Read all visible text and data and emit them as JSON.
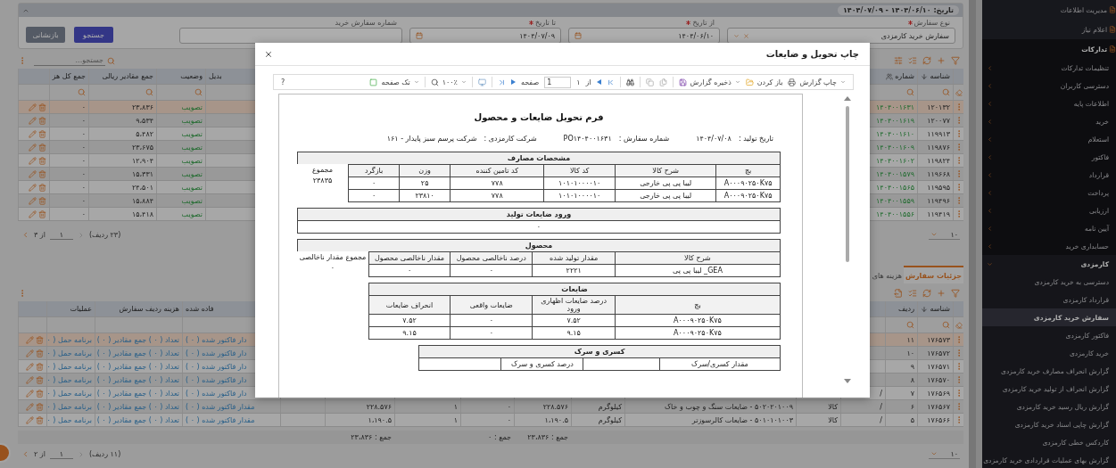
{
  "sidebar": {
    "items": [
      {
        "label": "مدیریت اطلاعات",
        "selected": false
      },
      {
        "label": "اعلام نیاز",
        "selected": false
      },
      {
        "label": "تدارکات",
        "selected": false,
        "children": [
          {
            "label": "تنظیمات تدارکات",
            "selected": false,
            "expanded": false
          },
          {
            "label": "دسترسی کاربران",
            "selected": false,
            "expanded": false
          },
          {
            "label": "اطلاعات پایه",
            "selected": false,
            "expanded": false
          },
          {
            "label": "خرید",
            "selected": false,
            "expanded": false
          },
          {
            "label": "استعلام",
            "selected": false,
            "expanded": false
          },
          {
            "label": "فاکتور",
            "selected": false,
            "expanded": false
          },
          {
            "label": "قرارداد",
            "selected": false,
            "expanded": false
          },
          {
            "label": "پرداخت",
            "selected": false,
            "expanded": false
          },
          {
            "label": "ارزیابی",
            "selected": false,
            "expanded": false
          },
          {
            "label": "آیین نامه",
            "selected": false,
            "expanded": false
          },
          {
            "label": "حسابداری خرید",
            "selected": false,
            "expanded": false
          },
          {
            "label": "کارمزدی",
            "selected": false,
            "expanded": true,
            "children": [
              {
                "label": "دسترسی به خرید کارمزدی",
                "selected": false
              },
              {
                "label": "قرارداد کارمزدی",
                "selected": false
              },
              {
                "label": "سفارش خرید کارمزدی",
                "selected": true
              },
              {
                "label": "فاکتور کارمزدی",
                "selected": false
              },
              {
                "label": "خرید کارمزدی",
                "selected": false
              },
              {
                "label": "گزارش انحراف مصارف خرید کارمزدی",
                "selected": false
              },
              {
                "label": "گزارش انحراف از تولید خرید کارمزدی",
                "selected": false
              },
              {
                "label": "گزارش ریال رسید خرید کارمزدی",
                "selected": false
              },
              {
                "label": "گزارش چاپی اسناد خرید کارمزدی",
                "selected": false
              },
              {
                "label": "کاردکس خطی کارمزدی",
                "selected": false
              },
              {
                "label": "گزارش بهای عملیات قراردادی خرید کارمزدی",
                "selected": false
              }
            ]
          }
        ]
      }
    ]
  },
  "filter": {
    "summary": "تاریخ: ۱۴۰۴/۰۶/۱۰ - ۱۴۰۴/۰۷/۰۹",
    "fields": [
      {
        "kind": "select",
        "label": "نوع سفارش",
        "required": true,
        "value": "سفارش خرید کارمزدی"
      },
      {
        "kind": "date",
        "label": "از تاریخ",
        "required": true,
        "value": "۱۴۰۴/۰۶/۱۰"
      },
      {
        "kind": "date",
        "label": "تا تاریخ",
        "required": true,
        "value": "۱۴۰۴/۰۷/۰۹"
      },
      {
        "kind": "text",
        "label": "شماره سفارش خرید",
        "required": false
      }
    ],
    "buttons": [
      {
        "kind": "primary",
        "label": "جستجو"
      },
      {
        "kind": "secondary",
        "label": "بازنشانی"
      }
    ]
  },
  "orders": {
    "search_placeholder": "جستجو...",
    "columns": {
      "id": {
        "label": "شناسه",
        "sorted_desc": true
      },
      "number": {
        "label": "شماره"
      },
      "col_3": {
        "label": "بدیل"
      },
      "status": {
        "label": "وضعیت"
      },
      "rial_total": {
        "label": "جمع مقادیر ریالی"
      },
      "total_cost": {
        "label": "جمع کل هز"
      }
    },
    "rows": [
      {
        "selected": true,
        "id": "۱۲۰۱۳۲",
        "number": "۱۴۰۴۰۰۱۶۳۱",
        "status": "تصویب",
        "rial_total": "۲۳،۸۳۶",
        "total_cost": "۰"
      },
      {
        "selected": false,
        "id": "۱۲۰۰۷۷",
        "number": "۱۴۰۴۰۰۱۶۱۹",
        "status": "تصویب",
        "rial_total": "۹،۵۳۴",
        "total_cost": "۰"
      },
      {
        "selected": false,
        "id": "۱۱۹۹۱۳",
        "number": "۱۴۰۴۰۰۱۶۱۰",
        "status": "تصویب",
        "rial_total": "۵،۴۸۲",
        "total_cost": "۰"
      },
      {
        "selected": false,
        "id": "۱۱۹۸۷۶",
        "number": "۱۴۰۴۰۰۱۶۰۹",
        "status": "تصویب",
        "rial_total": "۲۳،۶۷۵",
        "total_cost": "۰"
      },
      {
        "selected": false,
        "id": "۱۱۹۸۲۴",
        "number": "۱۴۰۴۰۰۱۶۰۲",
        "status": "تصویب",
        "rial_total": "۱۲،۹۰۴",
        "total_cost": "۰"
      },
      {
        "selected": false,
        "id": "۱۱۹۶۶۸",
        "number": "۱۴۰۴۰۰۱۵۷۹",
        "status": "تصویب",
        "rial_total": "۱۵،۳۳۱",
        "total_cost": "۰"
      },
      {
        "selected": false,
        "id": "۱۱۹۵۹۵",
        "number": "۱۴۰۴۰۰۱۵۶۵",
        "status": "تصویب",
        "rial_total": "۲۴،۵۰۱",
        "total_cost": "۰"
      },
      {
        "selected": false,
        "id": "۱۱۹۴۹۶",
        "number": "۱۴۰۴۰۰۱۵۵۹",
        "status": "تصویب",
        "rial_total": "۱۵،۸۸۴",
        "total_cost": "۰"
      },
      {
        "selected": false,
        "id": "۱۱۹۴۱۹",
        "number": "۱۴۰۴۰۰۱۵۵۶",
        "status": "تصویب",
        "rial_total": "۱۵،۴۱۸",
        "total_cost": "۰"
      }
    ],
    "pagination": {
      "rows_count": "(۲۳ ردیف)",
      "page": "۱",
      "of": "از ۳",
      "page_size": "۱۰"
    }
  },
  "order_details": {
    "tabs": [
      {
        "label": "جزئیات سفارش",
        "selected": true
      },
      {
        "label": "هزینه های",
        "selected": false
      }
    ],
    "columns": {
      "id": {
        "label": "شناسه",
        "sorted_desc": true
      },
      "row_no": {
        "label": "ردیف"
      },
      "invoiced": {
        "label": "فاده شده"
      },
      "order_row_cost": {
        "label": "هزینه ردیف سفارش"
      },
      "operations": {
        "label": "عملیات"
      }
    },
    "rows": [
      {
        "selected": true,
        "id": "۱۷۶۵۷۳",
        "row_no": "۱۱",
        "invoiced": "دار فاکتور شده ( ۰ )",
        "order_row_cost": "تعداد ( ۰ ) جمع مقادیر ( ۰ )",
        "operations": "برنامه حمل ( ۰"
      },
      {
        "selected": false,
        "id": "۱۷۶۵۷۲",
        "row_no": "۱۰",
        "invoiced": "دار فاکتور شده ( ۰ )",
        "order_row_cost": "تعداد ( ۰ ) جمع مقادیر ( ۰ )",
        "operations": "برنامه حمل ( ۰"
      },
      {
        "selected": false,
        "id": "۱۷۶۵۷۱",
        "row_no": "۹",
        "invoiced": "دار فاکتور شده ( ۰ )",
        "order_row_cost": "تعداد ( ۰ ) جمع مقادیر ( ۰ )",
        "operations": "برنامه حمل ( ۰"
      },
      {
        "selected": false,
        "id": "۱۷۶۵۷۰",
        "row_no": "۸",
        "invoiced": "دار فاکتور شده ( ۰ )",
        "order_row_cost": "تعداد ( ۰ ) جمع مقادیر ( ۰ )",
        "operations": "برنامه حمل ( ۰"
      },
      {
        "selected": false,
        "id": "۱۷۶۵۶۹",
        "row_no": "۷",
        "col_4": "/",
        "invoiced": "دار فاکتور شده ( ۰ )",
        "order_row_cost": "تعداد ( ۰ ) جمع مقادیر ( ۰ )",
        "operations": "برنامه حمل ( ۰"
      },
      {
        "selected": false,
        "id": "۱۷۶۵۶۷",
        "row_no": "۶",
        "col_4": "/",
        "col_5": "کالا",
        "col_6": "۵۰۲۰۲۰۱۰۰۹ - ضایعات سنگ و چوب و خاک",
        "col_7": "کیلوگرم",
        "col_8": "۲۲۸.۵۷۶",
        "col_9": "۰",
        "col_10": "۱",
        "col_11": "۲۲۸.۵۷۶",
        "invoiced": "مقدار فاکتور شده ( ۰ )",
        "order_row_cost": "تعداد ( ۰ ) جمع مقادیر ( ۰ )",
        "operations": "برنامه حمل ( ۰"
      },
      {
        "selected": false,
        "id": "۱۷۶۵۶۶",
        "row_no": "۵",
        "col_4": "/",
        "col_5": "کالا",
        "col_6": "۵۰۱۰۱۰۱۰۰۳ - ضایعات کالرسوزتر",
        "col_7": "کیلوگرم",
        "col_8": "۱،۱۹۰.۵",
        "col_9": "۰",
        "col_10": "۱",
        "col_11": "۱،۱۹۰.۵",
        "invoiced": "مقدار فاکتور شده ( ۰ )",
        "order_row_cost": "تعداد ( ۰ ) جمع مقادیر ( ۰ )",
        "operations": "برنامه حمل ( ۰"
      }
    ],
    "totals": {
      "col_8": "جمع : ۲۳،۸۳۶",
      "col_9": "جمع : ۰",
      "col_11": "جمع : ۲۳،۸۳۶"
    },
    "pagination": {
      "rows_count": "(۱۱ ردیف)",
      "page": "۱",
      "of": "از ۲",
      "page_size": "۱۰"
    }
  },
  "dialog": {
    "title": "چاپ تحویل و ضایعات",
    "toolbar": {
      "print": "چاپ گزارش",
      "open": "باز کردن",
      "save": "ذخیره گزارش",
      "of": "از",
      "page_count": "۱",
      "page": "1",
      "page_label": "صفحه",
      "zoom": "۱۰۰٪",
      "view": "تک صفحه",
      "help": "?"
    },
    "report": {
      "title": "فرم تحویل ضایعات و محصول",
      "info": [
        {
          "label": "تاریخ تولید :",
          "value": "۱۴۰۴/۰۷/۰۸"
        },
        {
          "label": "شماره سفارش :",
          "value": "PO۱۴۰۴۰۰۱۶۳۱"
        },
        {
          "label": "شرکت کارمزدی :",
          "value": "شرکت پرسم سبز پایدار - ۱۶۱"
        }
      ],
      "tables": [
        {
          "kind": "grid",
          "title": "مشخصات مصارف",
          "columns": [
            "بچ",
            "شرح کالا",
            "کد کالا",
            "کد تامین کننده",
            "وزن",
            "بازگرد"
          ],
          "rows": [
            [
              "A۰۰۰۹۰۲۵۰K۷۵",
              "لیبا پی پی خارجی",
              "۱۰۱۰۱۰۰۰۰۱۰",
              "۷۷۸",
              "۲۵",
              "۰"
            ],
            [
              "A۰۰۰۹۰۲۵۰K۷۵",
              "لیبا پی پی خارجی",
              "۱۰۱۰۱۰۰۰۰۱۰",
              "۷۷۸",
              "۲۳۸۱۰",
              "۰"
            ]
          ],
          "side": {
            "label": "مجموع",
            "value": "۲۳۸۳۵"
          }
        },
        {
          "kind": "single",
          "title": "ورود ضایعات تولید",
          "value": "۰"
        },
        {
          "kind": "grid",
          "title": "محصول",
          "columns": [
            "شرح کالا",
            "مقدار تولید شده",
            "درصد ناخالصی محصول",
            "مقدار ناخالصی محصول"
          ],
          "rows": [
            [
              "GEA_ لیبا پی پی",
              "۲۲۲۱",
              "۰",
              "۰"
            ]
          ],
          "side": {
            "label": "مجموع مقدار ناخالصی",
            "value": "۰"
          }
        },
        {
          "kind": "grid",
          "title": "ضایعات",
          "columns": [
            "بچ",
            "درصد ضایعات اظهاری ورود",
            "ضایعات واقعی",
            "انحراف ضایعات"
          ],
          "rows": [
            [
              "A۰۰۰۹۰۲۵۰K۷۵",
              "۷.۵۲",
              "۰",
              "۷.۵۲"
            ],
            [
              "A۰۰۰۹۰۲۵۰K۷۵",
              "۹.۱۵",
              "۰",
              "۹.۱۵"
            ]
          ]
        },
        {
          "kind": "pairs",
          "title": "کسری و سرک",
          "labels": [
            "مقدار کسری/سرک",
            "درصد کسری و سرک"
          ]
        }
      ]
    }
  }
}
